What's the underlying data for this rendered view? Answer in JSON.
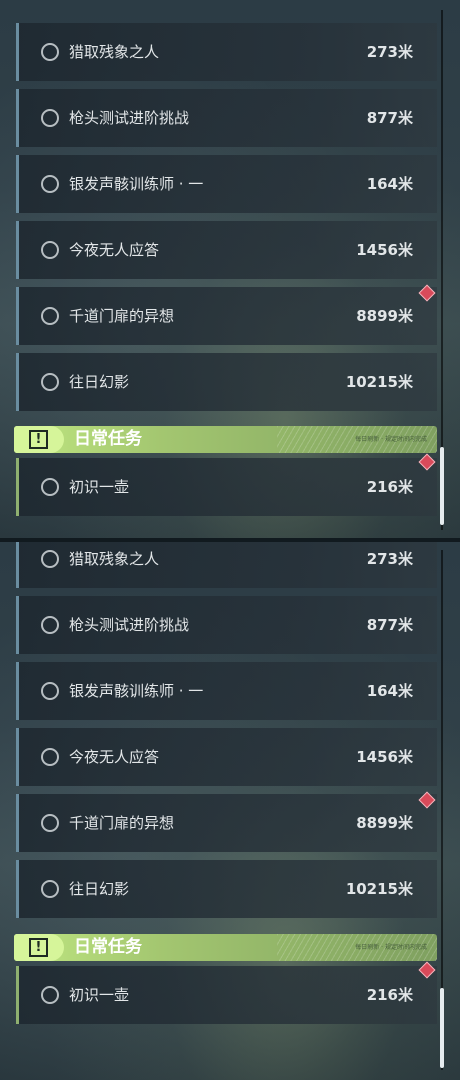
{
  "quests": [
    {
      "title": "猎取残象之人",
      "distance": "273米"
    },
    {
      "title": "枪头测试进阶挑战",
      "distance": "877米"
    },
    {
      "title": "银发声骸训练师 · 一",
      "distance": "164米"
    },
    {
      "title": "今夜无人应答",
      "distance": "1456米"
    },
    {
      "title": "千道门扉的异想",
      "distance": "8899米"
    },
    {
      "title": "往日幻影",
      "distance": "10215米"
    }
  ],
  "daily_header": {
    "label": "日常任务",
    "small_text": "每日刷新 · 规定时间内完成",
    "icon": "alert-icon"
  },
  "daily_quests": [
    {
      "title": "初识一壶",
      "distance": "216米"
    }
  ],
  "colors": {
    "quest_accent": "#6a8da0",
    "daily_accent": "#8fb070",
    "header_green": "#b7dd7c",
    "tracking_marker": "#d94a5a"
  }
}
